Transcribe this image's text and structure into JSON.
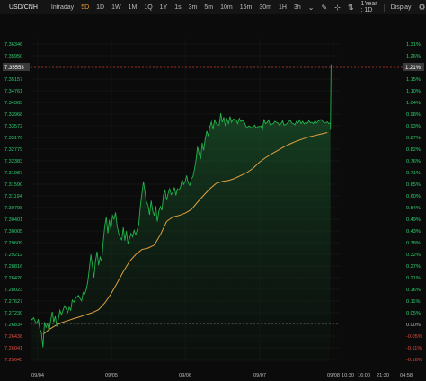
{
  "toolbar": {
    "symbol": "USD/CNH",
    "timeframes": [
      "Intraday",
      "5D",
      "1D",
      "1W",
      "1M",
      "1Q",
      "1Y",
      "1s",
      "3m",
      "5m",
      "10m",
      "15m",
      "30m",
      "1H",
      "3h"
    ],
    "active_timeframe": "5D",
    "range_label": "1Year : 1D",
    "display_label": "Display"
  },
  "chart_data": {
    "type": "line",
    "title": "",
    "xlabel": "",
    "ylabel": "",
    "ylim": [
      7.2558,
      7.365
    ],
    "y_ticks": [
      "7.36346",
      "7.35950",
      "7.35553",
      "7.35157",
      "7.34761",
      "7.34365",
      "7.33968",
      "7.33572",
      "7.33176",
      "7.32779",
      "7.32383",
      "7.31987",
      "7.31590",
      "7.31194",
      "7.30798",
      "7.30401",
      "7.30005",
      "7.29609",
      "7.29212",
      "7.28816",
      "7.28420",
      "7.28023",
      "7.27627",
      "7.27230",
      "7.26834",
      "7.26438",
      "7.26041",
      "7.25645"
    ],
    "pct_ticks": [
      "1.31%",
      "1.26%",
      "1.21%",
      "1.15%",
      "1.10%",
      "1.04%",
      "0.98%",
      "0.93%",
      "0.87%",
      "0.82%",
      "0.76%",
      "0.71%",
      "0.65%",
      "0.60%",
      "0.54%",
      "0.49%",
      "0.43%",
      "0.38%",
      "0.32%",
      "0.27%",
      "0.21%",
      "0.16%",
      "0.11%",
      "0.05%",
      "0.00%",
      "-0.05%",
      "-0.11%",
      "-0.16%"
    ],
    "x_ticks": [
      "09/04",
      "09/05",
      "09/06",
      "09/07",
      "09/08",
      "10:30",
      "16:00",
      "21:30",
      "04:58"
    ],
    "baseline": 7.26834,
    "last_price_label": "7.35553",
    "last_pct_label": "1.21%",
    "price_series": {
      "name": "",
      "color": "#22b34a",
      "x": [
        0,
        0.5,
        1,
        1.5,
        2,
        2.5,
        3,
        3.5,
        4,
        4.5,
        5,
        5.5,
        6,
        6.5,
        7,
        7.5,
        8,
        8.5,
        9,
        9.5,
        10,
        10.5,
        11,
        11.5,
        12,
        12.5,
        13,
        13.5,
        14,
        14.5,
        15,
        15.5,
        16,
        16.5,
        17,
        17.5,
        18,
        18.5,
        19,
        19.5,
        20,
        20.5,
        21,
        21.5,
        22,
        22.5,
        23,
        23.5,
        24,
        24.5,
        25,
        25.5,
        26,
        26.5,
        27,
        27.5,
        28,
        28.5,
        29,
        29.5,
        30,
        30.5,
        31,
        31.5,
        32,
        32.5,
        33,
        33.5,
        34,
        34.5,
        35,
        35.5,
        36,
        36.5,
        37,
        37.5,
        38,
        38.5,
        39,
        39.5,
        40,
        40.5,
        41,
        41.5,
        42,
        42.5,
        43,
        43.5,
        44,
        44.5,
        45,
        45.5,
        46,
        46.5,
        47,
        47.5,
        48,
        48.5,
        49,
        49.5,
        50,
        50.5,
        51,
        51.5,
        52,
        52.5,
        53,
        53.5,
        54,
        54.5,
        55,
        55.5,
        56,
        56.5,
        57,
        57.5,
        58,
        58.5,
        59,
        59.5,
        60,
        60.5,
        61,
        61.5,
        62,
        62.5,
        63,
        63.5,
        64,
        64.5,
        65,
        65.5,
        66,
        66.5,
        67,
        67.5,
        68,
        68.5,
        69,
        69.5,
        70,
        70.5,
        71,
        71.5,
        72,
        72.5,
        73,
        73.5,
        74,
        74.5,
        75,
        75.5,
        76,
        76.5,
        77,
        77.5,
        78,
        78.5,
        79,
        79.5,
        80,
        80.5,
        81,
        81.5,
        82,
        82.5,
        83,
        83.5,
        84,
        84.5,
        85,
        85.5,
        86,
        86.5,
        87,
        87.5,
        88,
        88.5,
        89,
        89.5,
        90,
        90.5,
        91,
        91.5,
        92,
        92.5,
        93,
        93.5,
        94,
        94.5,
        95,
        95.5,
        96,
        96.5,
        97
      ],
      "values": [
        7.2703,
        7.2698,
        7.2705,
        7.2692,
        7.2685,
        7.27,
        7.2668,
        7.2655,
        7.2605,
        7.269,
        7.2672,
        7.2685,
        7.266,
        7.2695,
        7.2725,
        7.269,
        7.271,
        7.2675,
        7.2702,
        7.273,
        7.2715,
        7.273,
        7.2745,
        7.2735,
        7.2722,
        7.274,
        7.273,
        7.2765,
        7.2758,
        7.277,
        7.2775,
        7.278,
        7.277,
        7.2762,
        7.279,
        7.2785,
        7.28,
        7.2825,
        7.287,
        7.2918,
        7.288,
        7.284,
        7.2895,
        7.2928,
        7.2882,
        7.291,
        7.2895,
        7.296,
        7.3015,
        7.3045,
        7.299,
        7.3035,
        7.3002,
        7.305,
        7.3038,
        7.306,
        7.3015,
        7.299,
        7.2975,
        7.2968,
        7.301,
        7.2965,
        7.2998,
        7.2955,
        7.2972,
        7.299,
        7.2978,
        7.3,
        7.2985,
        7.3002,
        7.302,
        7.308,
        7.3122,
        7.3165,
        7.313,
        7.3095,
        7.3085,
        7.3052,
        7.31,
        7.3065,
        7.305,
        7.3082,
        7.303,
        7.3065,
        7.308,
        7.3068,
        7.312,
        7.3135,
        7.3102,
        7.3125,
        7.314,
        7.312,
        7.3128,
        7.3145,
        7.3118,
        7.314,
        7.3135,
        7.3145,
        7.3172,
        7.3155,
        7.3165,
        7.3185,
        7.316,
        7.3152,
        7.3175,
        7.318,
        7.3205,
        7.3235,
        7.3282,
        7.326,
        7.324,
        7.3295,
        7.327,
        7.331,
        7.3335,
        7.3318,
        7.335,
        7.3366,
        7.334,
        7.3372,
        7.3362,
        7.3356,
        7.3355,
        7.3395,
        7.3365,
        7.3382,
        7.3352,
        7.3376,
        7.336,
        7.3384,
        7.3365,
        7.3375,
        7.3375,
        7.3372,
        7.336,
        7.3378,
        7.3368,
        7.337,
        7.3368,
        7.3355,
        7.3345,
        7.3352,
        7.335,
        7.3345,
        7.335,
        7.3355,
        7.3345,
        7.335,
        7.335,
        7.3352,
        7.334,
        7.3375,
        7.336,
        7.3364,
        7.3372,
        7.3356,
        7.3358,
        7.336,
        7.3368,
        7.3365,
        7.3362,
        7.3355,
        7.336,
        7.337,
        7.3355,
        7.3357,
        7.3361,
        7.3368,
        7.337,
        7.3362,
        7.336,
        7.3356,
        7.3368,
        7.3362,
        7.3372,
        7.336,
        7.3368,
        7.3359,
        7.3365,
        7.3361,
        7.337,
        7.3363,
        7.3365,
        7.336,
        7.337,
        7.3362,
        7.3368,
        7.3372,
        7.3374,
        7.3368,
        7.3362,
        7.3363,
        7.3366,
        7.336,
        7.3362
      ]
    },
    "ma_series": {
      "name": "",
      "color": "#e0a040",
      "x": [
        4,
        6,
        8,
        10,
        12,
        14,
        16,
        18,
        20,
        22,
        24,
        26,
        28,
        30,
        32,
        34,
        36,
        38,
        40,
        42,
        44,
        46,
        48,
        50,
        52,
        54,
        56,
        58,
        60,
        62,
        64,
        66,
        68,
        70,
        72,
        74,
        76,
        78,
        80,
        82,
        84,
        86,
        88,
        90,
        92,
        94,
        96
      ],
      "values": [
        7.2648,
        7.2665,
        7.2678,
        7.2688,
        7.2695,
        7.2702,
        7.2708,
        7.2715,
        7.2722,
        7.2732,
        7.2755,
        7.2785,
        7.2822,
        7.286,
        7.2895,
        7.2918,
        7.2935,
        7.294,
        7.295,
        7.2985,
        7.303,
        7.3045,
        7.305,
        7.3058,
        7.307,
        7.3095,
        7.3118,
        7.314,
        7.3158,
        7.3165,
        7.3168,
        7.3175,
        7.3185,
        7.3195,
        7.321,
        7.323,
        7.3245,
        7.3258,
        7.327,
        7.3282,
        7.3292,
        7.3301,
        7.3308,
        7.3315,
        7.332,
        7.3325,
        7.333
      ]
    },
    "spike": {
      "x": [
        97,
        97.2
      ],
      "values": [
        7.334,
        7.356
      ]
    }
  }
}
